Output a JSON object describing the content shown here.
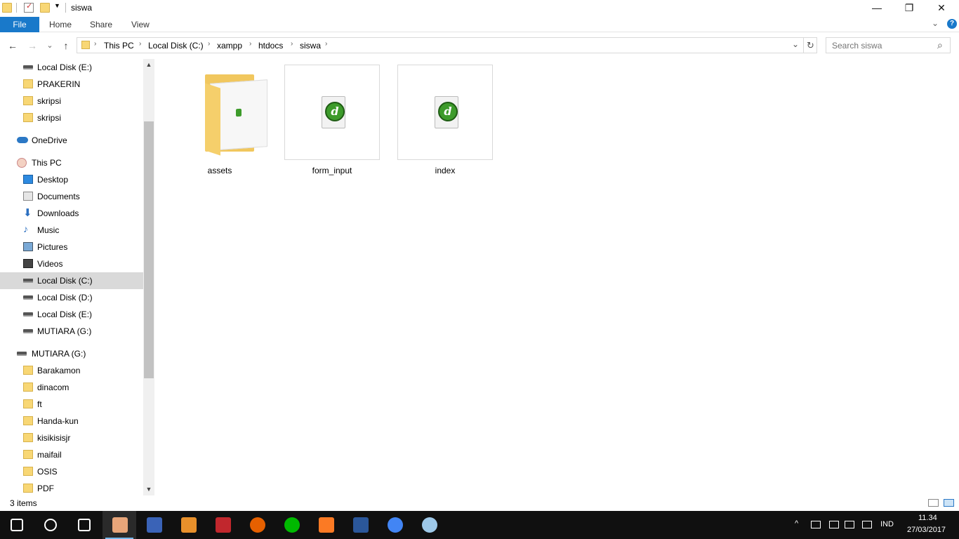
{
  "window": {
    "title": "siswa",
    "minimize_glyph": "—",
    "maximize_glyph": "❐",
    "close_glyph": "✕"
  },
  "ribbon": {
    "tabs": [
      "File",
      "Home",
      "Share",
      "View"
    ],
    "expand_glyph": "⌄",
    "help_glyph": "?"
  },
  "nav": {
    "back": "←",
    "forward": "→",
    "recent": "⌄",
    "up": "↑",
    "breadcrumb": [
      "This PC",
      "Local Disk (C:)",
      "xampp",
      "htdocs",
      "siswa"
    ],
    "separator": "›",
    "dropdown": "⌄",
    "refresh": "↻"
  },
  "search": {
    "placeholder": "Search siswa",
    "icon": "⌕"
  },
  "nav_pane": {
    "items": [
      {
        "label": "Local Disk (E:)",
        "icon": "drive-icon",
        "indent": 1
      },
      {
        "label": "PRAKERIN",
        "icon": "folder-icon",
        "indent": 1
      },
      {
        "label": "skripsi",
        "icon": "folder-icon",
        "indent": 1
      },
      {
        "label": "skripsi",
        "icon": "folder-icon",
        "indent": 1
      },
      {
        "label": "OneDrive",
        "icon": "onedrive-icon",
        "indent": 0
      },
      {
        "label": "This PC",
        "icon": "this-pc-icon",
        "indent": 0
      },
      {
        "label": "Desktop",
        "icon": "desktop-icon",
        "indent": 1
      },
      {
        "label": "Documents",
        "icon": "documents-icon",
        "indent": 1
      },
      {
        "label": "Downloads",
        "icon": "downloads-icon",
        "indent": 1
      },
      {
        "label": "Music",
        "icon": "music-icon",
        "indent": 1
      },
      {
        "label": "Pictures",
        "icon": "pictures-icon",
        "indent": 1
      },
      {
        "label": "Videos",
        "icon": "videos-icon",
        "indent": 1
      },
      {
        "label": "Local Disk (C:)",
        "icon": "windows-drive-icon",
        "indent": 1,
        "selected": true
      },
      {
        "label": "Local Disk (D:)",
        "icon": "drive-icon",
        "indent": 1
      },
      {
        "label": "Local Disk (E:)",
        "icon": "drive-icon",
        "indent": 1
      },
      {
        "label": "MUTIARA (G:)",
        "icon": "drive-icon",
        "indent": 1
      },
      {
        "label": "MUTIARA (G:)",
        "icon": "drive-icon",
        "indent": 0
      },
      {
        "label": "Barakamon",
        "icon": "folder-icon",
        "indent": 1
      },
      {
        "label": "dinacom",
        "icon": "folder-icon",
        "indent": 1
      },
      {
        "label": "ft",
        "icon": "folder-icon",
        "indent": 1
      },
      {
        "label": "Handa-kun",
        "icon": "folder-icon",
        "indent": 1
      },
      {
        "label": "kisikisisjr",
        "icon": "folder-icon",
        "indent": 1
      },
      {
        "label": "maifail",
        "icon": "folder-icon",
        "indent": 1
      },
      {
        "label": "OSIS",
        "icon": "folder-icon",
        "indent": 1
      },
      {
        "label": "PDF",
        "icon": "folder-icon",
        "indent": 1
      }
    ],
    "scroll_up": "▲",
    "scroll_down": "▼"
  },
  "files": [
    {
      "name": "assets",
      "type": "folder"
    },
    {
      "name": "form_input",
      "type": "dreamweaver-file"
    },
    {
      "name": "index",
      "type": "dreamweaver-file"
    }
  ],
  "status": {
    "count": "3 items"
  },
  "taskbar": {
    "apps": [
      {
        "name": "start-icon",
        "color": "#ffffff"
      },
      {
        "name": "search-icon",
        "color": "#ffffff"
      },
      {
        "name": "task-view-icon",
        "color": "#ffffff"
      },
      {
        "name": "file-explorer-app-icon",
        "color": "#e7a57a",
        "active": true
      },
      {
        "name": "visual-basic-app-icon",
        "color": "#3a63b7"
      },
      {
        "name": "sublime-text-app-icon",
        "color": "#e8902b"
      },
      {
        "name": "spss-app-icon",
        "color": "#c1272d"
      },
      {
        "name": "firefox-app-icon",
        "color": "#e66000"
      },
      {
        "name": "line-app-icon",
        "color": "#00b900"
      },
      {
        "name": "xampp-app-icon",
        "color": "#fb7a24"
      },
      {
        "name": "word-app-icon",
        "color": "#2b579a"
      },
      {
        "name": "chrome-app-icon",
        "color": "#4285f4"
      },
      {
        "name": "paint-app-icon",
        "color": "#9ec8e8"
      }
    ],
    "tray_chevron": "^",
    "language": "IND",
    "time": "11.34",
    "date": "27/03/2017"
  }
}
